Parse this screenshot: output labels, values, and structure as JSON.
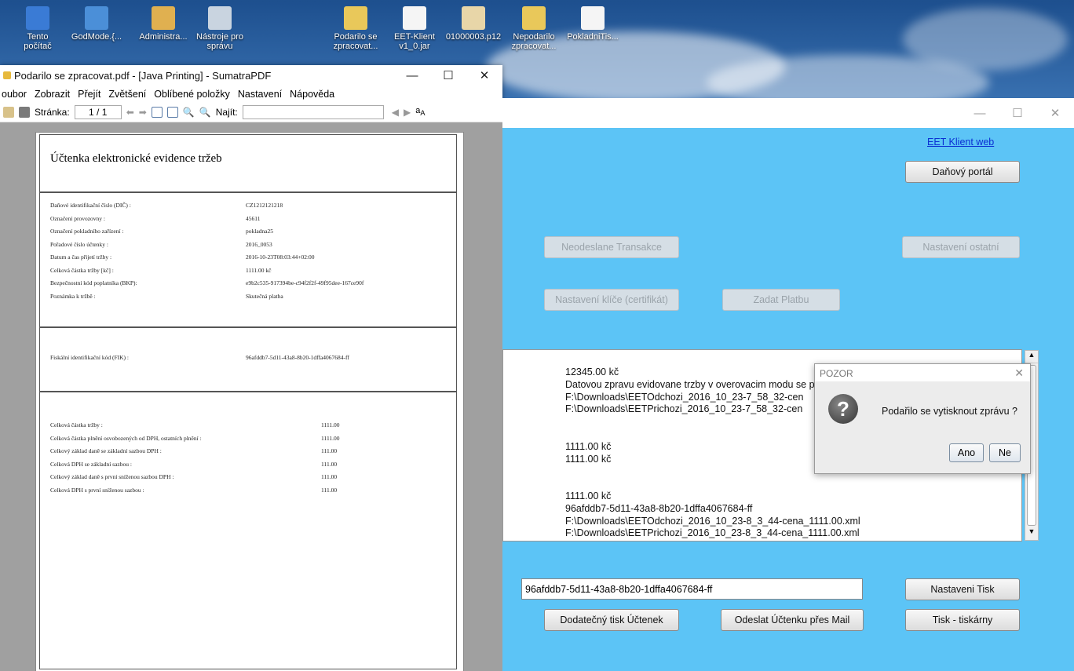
{
  "desktop": {
    "icons": [
      {
        "label": "Tento\npočítač",
        "icon": "computer-icon"
      },
      {
        "label": "GodMode.{...",
        "icon": "control-panel-icon"
      },
      {
        "label": "Administra...",
        "icon": "user-folder-icon"
      },
      {
        "label": "Nástroje pro\nsprávu",
        "icon": "admin-tools-icon"
      },
      {
        "label": "Podarilo se\nzpracovat...",
        "icon": "pdf-icon"
      },
      {
        "label": "EET-Klient\nv1_0.jar",
        "icon": "java-icon"
      },
      {
        "label": "01000003.p12",
        "icon": "certificate-icon"
      },
      {
        "label": "Nepodarilo\nzpracovat...",
        "icon": "pdf-icon"
      },
      {
        "label": "PokladniTis...",
        "icon": "java-icon"
      }
    ]
  },
  "sumatra": {
    "title": "Podarilo se zpracovat.pdf - [Java Printing] - SumatraPDF",
    "menu": [
      "oubor",
      "Zobrazit",
      "Přejít",
      "Zvětšení",
      "Oblíbené položky",
      "Nastavení",
      "Nápověda"
    ],
    "toolbar": {
      "page_label": "Stránka:",
      "page_value": "1 / 1",
      "find_label": "Najít:"
    },
    "receipt": {
      "title": "Účtenka elektronické evidence tržeb",
      "section1": [
        {
          "label": "Daňové identifikační číslo (DIČ) :",
          "value": "CZ1212121218"
        },
        {
          "label": "Označení provozovny :",
          "value": "45611"
        },
        {
          "label": "Označení pokladního zařízení :",
          "value": "pokladna25"
        },
        {
          "label": "Pořadové číslo účtenky :",
          "value": "2016_0053"
        },
        {
          "label": "Datum a čas přijetí tržby :",
          "value": "2016-10-23T08:03:44+02:00"
        },
        {
          "label": "Celková částka tržby [kč] :",
          "value": "1111.00 kč"
        },
        {
          "label": "Bezpečnostní kód poplatníka (BKP):",
          "value": "e9b2c535-917394be-c94f2f2f-49f95dee-167ce90f"
        },
        {
          "label": "Poznámka k tržbě :",
          "value": "Skutečná platba"
        }
      ],
      "fik": {
        "label": "Fiskální identifikační kód (FIK) :",
        "value": "96afddb7-5d11-43a8-8b20-1dffa4067684-ff"
      },
      "section3": [
        {
          "label": "Celková částka tržby :",
          "value": "1111.00"
        },
        {
          "label": "Celková částka plnění osvobozených od DPH, ostatních plnění :",
          "value": "1111.00"
        },
        {
          "label": "Celkový základ daně se základní sazbou DPH :",
          "value": "111.00"
        },
        {
          "label": "Celková DPH se základní sazbou :",
          "value": "111.00"
        },
        {
          "label": "Celkový základ daně s první sníženou sazbou DPH :",
          "value": "111.00"
        },
        {
          "label": "Celková DPH s první sníženou sazbou :",
          "value": "111.00"
        }
      ]
    }
  },
  "eet": {
    "link": "EET Klient web",
    "buttons": {
      "danovy_portal": "Daňový portál",
      "neodeslane": "Neodeslane Transakce",
      "nastaveni_ostatni": "Nastavení ostatní",
      "nastaveni_klice": "Nastavení klíče (certifikát)",
      "zadat_platbu": "Zadat Platbu",
      "nastaveni_tisk": "Nastaveni Tisk",
      "dodatecny_tisk": "Dodatečný tisk Účtenek",
      "odeslat_mail": "Odeslat Účtenku přes Mail",
      "tisk_tiskarny": "Tisk - tiskárny"
    },
    "log": [
      "12345.00        kč",
      "Datovou zpravu evidovane trzby v overovacim modu se p",
      "F:\\Downloads\\EETOdchozi_2016_10_23-7_58_32-cen",
      "F:\\Downloads\\EETPrichozi_2016_10_23-7_58_32-cen",
      "",
      "",
      "1111.00          kč",
      "1111.00          kč",
      "",
      "",
      "1111.00          kč",
      "96afddb7-5d11-43a8-8b20-1dffa4067684-ff",
      "F:\\Downloads\\EETOdchozi_2016_10_23-8_3_44-cena_1111.00.xml",
      "F:\\Downloads\\EETPrichozi_2016_10_23-8_3_44-cena_1111.00.xml"
    ],
    "fik_field": "96afddb7-5d11-43a8-8b20-1dffa4067684-ff"
  },
  "dialog": {
    "title": "POZOR",
    "message": "Podařilo se vytisknout zprávu ?",
    "yes": "Ano",
    "no": "Ne"
  }
}
